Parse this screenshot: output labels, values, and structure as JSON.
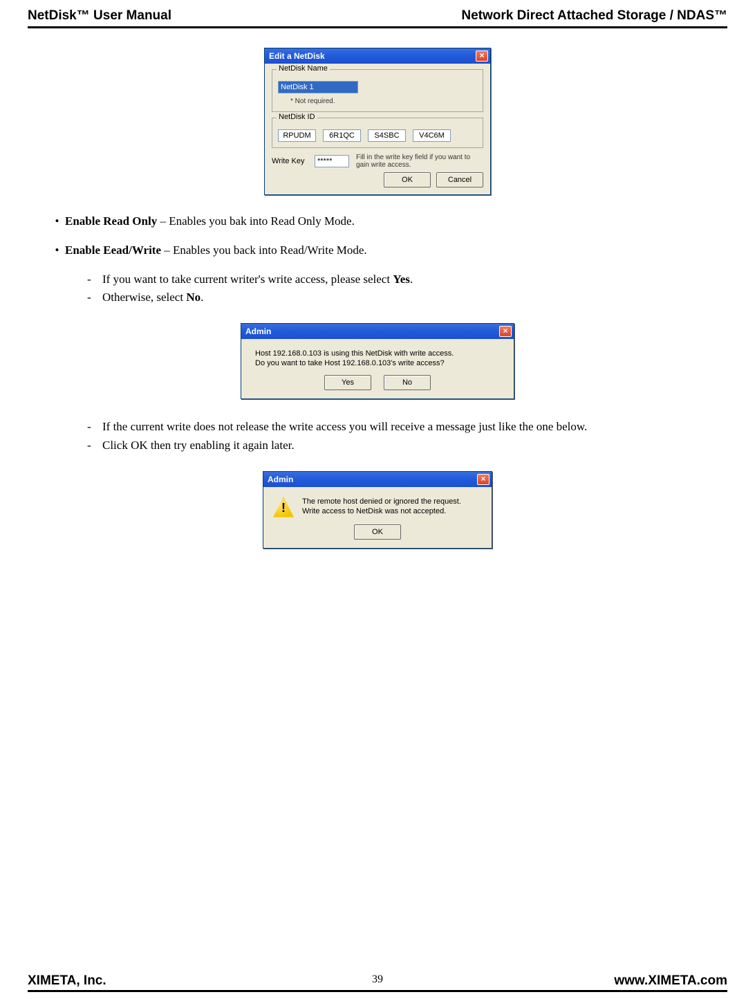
{
  "header": {
    "left": "NetDisk™ User Manual",
    "right": "Network Direct Attached Storage / NDAS™"
  },
  "dlg_edit": {
    "title": "Edit a NetDisk",
    "name_legend": "NetDisk Name",
    "name_value": "NetDisk 1",
    "name_note": "* Not required.",
    "id_legend": "NetDisk ID",
    "id": [
      "RPUDM",
      "6R1QC",
      "S4SBC",
      "V4C6M"
    ],
    "wk_label": "Write Key",
    "wk_value": "*****",
    "wk_hint": "Fill in the write key field if you want to gain write access.",
    "ok": "OK",
    "cancel": "Cancel"
  },
  "bul1": {
    "strong": "Enable Read Only",
    "rest": " – Enables you bak into Read Only Mode."
  },
  "bul2": {
    "strong": "Enable Eead/Write",
    "rest": " – Enables you back into Read/Write Mode."
  },
  "dashA": {
    "i1a": "If you want to take current writer's write access, please select ",
    "i1b": "Yes",
    "i1c": ".",
    "i2a": "Otherwise, select ",
    "i2b": "No",
    "i2c": "."
  },
  "dlg_admin1": {
    "title": "Admin",
    "line1": "Host 192.168.0.103 is using this NetDisk with write access.",
    "line2": "Do you want to take Host  192.168.0.103's write access?",
    "yes": "Yes",
    "no": "No"
  },
  "dashB": {
    "i1": "If the current write does not release the write access you will receive a message just like the one below.",
    "i2": "Click OK then try enabling it again later."
  },
  "dlg_admin2": {
    "title": "Admin",
    "line1": "The remote host denied or ignored the request.",
    "line2": "Write access to NetDisk was not accepted.",
    "ok": "OK"
  },
  "footer": {
    "left": "XIMETA, Inc.",
    "page": "39",
    "right": "www.XIMETA.com"
  }
}
